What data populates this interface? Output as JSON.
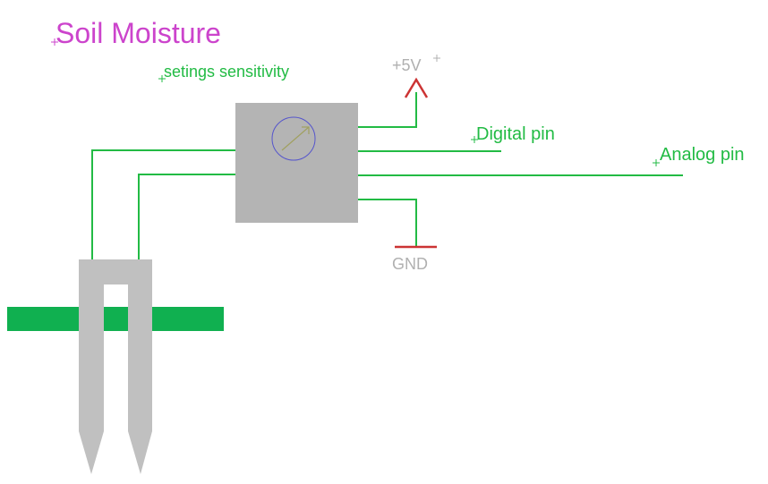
{
  "title": "Soil Moisture",
  "labels": {
    "sensitivity": "setings sensitivity",
    "vcc": "+5V",
    "digital": "Digital pin",
    "analog": "Analog pin",
    "gnd": "GND"
  },
  "colors": {
    "title": "#cc44cc",
    "wire": "#22bb44",
    "module": "#b4b4b4",
    "power": "#cc3333",
    "power_label": "#b0b0b0",
    "probe": "#c0c0c0",
    "ground_strip": "#10b050",
    "pot_circle": "#5555cc",
    "pot_arrow": "#a0a060"
  },
  "icons": {
    "pot": "potentiometer-icon",
    "vcc": "power-arrow-icon",
    "gnd": "ground-icon"
  }
}
